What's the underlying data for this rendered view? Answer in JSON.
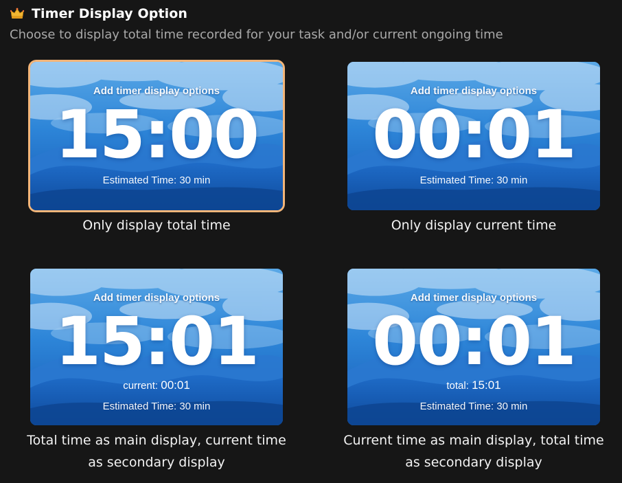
{
  "header": {
    "icon": "crown-icon",
    "title": "Timer Display Option",
    "subtitle": "Choose to display total time recorded for your task and/or current ongoing time"
  },
  "options": [
    {
      "card": {
        "header": "Add timer display options",
        "time": "15:00",
        "estimate": "Estimated Time: 30 min"
      },
      "caption": "Only display total time",
      "selected": true
    },
    {
      "card": {
        "header": "Add timer display options",
        "time": "00:01",
        "estimate": "Estimated Time: 30 min"
      },
      "caption": "Only display current time",
      "selected": false
    },
    {
      "card": {
        "header": "Add timer display options",
        "time": "15:01",
        "secondary_label": "current:",
        "secondary_value": "00:01",
        "estimate": "Estimated Time: 30 min"
      },
      "caption": "Total time as main display, current time as secondary display",
      "selected": false
    },
    {
      "card": {
        "header": "Add timer display options",
        "time": "00:01",
        "secondary_label": "total:",
        "secondary_value": "15:01",
        "estimate": "Estimated Time: 30 min"
      },
      "caption": "Current time as main display, total time as secondary display",
      "selected": false
    }
  ],
  "colors": {
    "background": "#161616",
    "selected_outline": "#f3b579",
    "card_sky": "#1e6fc9",
    "mountain_dark": "#0f4f9e"
  }
}
